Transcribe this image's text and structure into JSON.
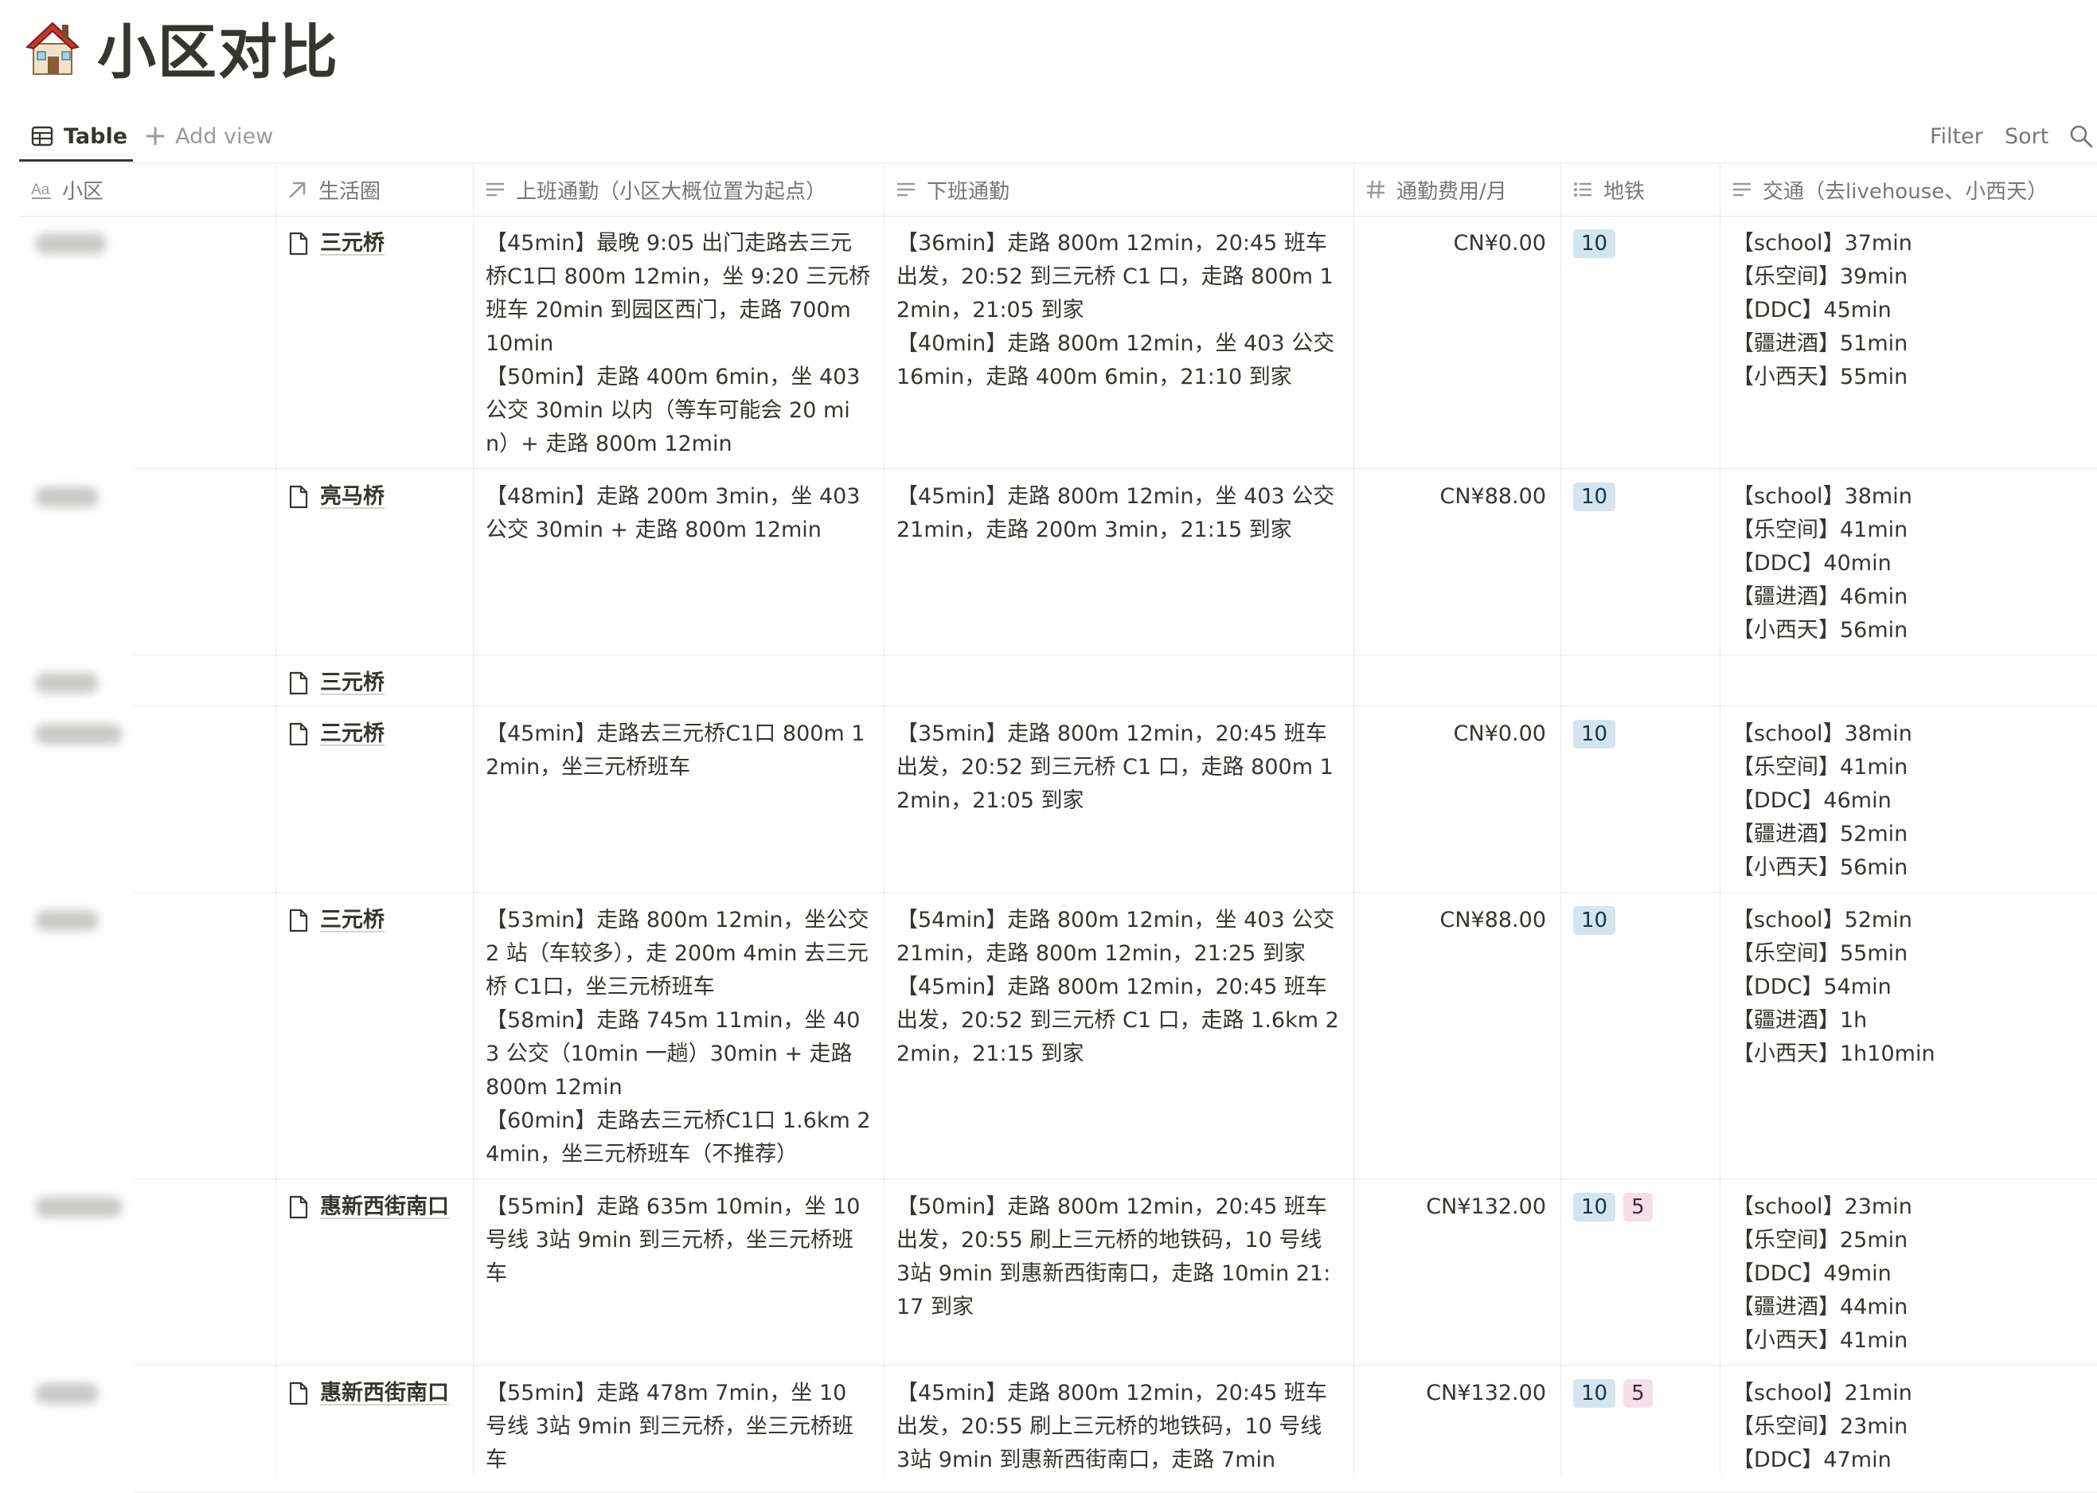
{
  "page": {
    "title": "小区对比",
    "icon": "house-icon"
  },
  "view_bar": {
    "tab_label": "Table",
    "add_view_label": "Add view",
    "filter_label": "Filter",
    "sort_label": "Sort"
  },
  "columns": [
    {
      "label": "小区",
      "icon": "title-aa-icon"
    },
    {
      "label": "生活圈",
      "icon": "relation-arrow-icon"
    },
    {
      "label": "上班通勤（小区大概位置为起点）",
      "icon": "text-lines-icon"
    },
    {
      "label": "下班通勤",
      "icon": "text-lines-icon"
    },
    {
      "label": "通勤费用/月",
      "icon": "number-hash-icon"
    },
    {
      "label": "地铁",
      "icon": "multi-select-list-icon"
    },
    {
      "label": "交通（去livehouse、小西天）",
      "icon": "text-lines-icon"
    }
  ],
  "rows": [
    {
      "circle": "三元桥",
      "morning": [
        "【45min】最晚 9:05 出门走路去三元桥C1口 800m 12min，坐 9:20 三元桥班车 20min 到园区西门，走路 700m 10min",
        "【50min】走路 400m 6min，坐 403 公交 30min 以内（等车可能会 20 min）+ 走路 800m 12min"
      ],
      "evening": [
        "【36min】走路 800m 12min，20:45 班车出发，20:52 到三元桥 C1 口，走路 800m 12min，21:05 到家",
        "【40min】走路 800m 12min，坐 403 公交 16min，走路 400m 6min，21:10 到家"
      ],
      "cost": "CN¥0.00",
      "subway": [
        "10"
      ],
      "transit": [
        "【school】37min",
        "【乐空间】39min",
        "【DDC】45min",
        "【疆进酒】51min",
        "【小西天】55min"
      ]
    },
    {
      "circle": "亮马桥",
      "morning": [
        "【48min】走路 200m 3min，坐 403 公交 30min + 走路 800m 12min"
      ],
      "evening": [
        "【45min】走路 800m 12min，坐 403 公交 21min，走路 200m 3min，21:15 到家"
      ],
      "cost": "CN¥88.00",
      "subway": [
        "10"
      ],
      "transit": [
        "【school】38min",
        "【乐空间】41min",
        "【DDC】40min",
        "【疆进酒】46min",
        "【小西天】56min"
      ]
    },
    {
      "circle": "三元桥",
      "morning": [],
      "evening": [],
      "cost": "",
      "subway": [],
      "transit": []
    },
    {
      "circle": "三元桥",
      "morning": [
        "【45min】走路去三元桥C1口 800m 12min，坐三元桥班车"
      ],
      "evening": [
        "【35min】走路 800m 12min，20:45 班车出发，20:52 到三元桥 C1 口，走路 800m 12min，21:05 到家"
      ],
      "cost": "CN¥0.00",
      "subway": [
        "10"
      ],
      "transit": [
        "【school】38min",
        "【乐空间】41min",
        "【DDC】46min",
        "【疆进酒】52min",
        "【小西天】56min"
      ]
    },
    {
      "circle": "三元桥",
      "morning": [
        "【53min】走路 800m 12min，坐公交 2 站（车较多），走 200m 4min 去三元桥 C1口，坐三元桥班车",
        "【58min】走路 745m 11min，坐 403 公交（10min 一趟）30min + 走路 800m 12min",
        "【60min】走路去三元桥C1口 1.6km 24min，坐三元桥班车（不推荐）"
      ],
      "evening": [
        "【54min】走路 800m 12min，坐 403 公交 21min，走路 800m 12min，21:25 到家",
        "【45min】走路 800m 12min，20:45 班车出发，20:52 到三元桥 C1 口，走路 1.6km 22min，21:15 到家"
      ],
      "cost": "CN¥88.00",
      "subway": [
        "10"
      ],
      "transit": [
        "【school】52min",
        "【乐空间】55min",
        "【DDC】54min",
        "【疆进酒】1h",
        "【小西天】1h10min"
      ]
    },
    {
      "circle": "惠新西街南口",
      "morning": [
        "【55min】走路 635m 10min，坐 10 号线 3站 9min 到三元桥，坐三元桥班车"
      ],
      "evening": [
        "【50min】走路 800m 12min，20:45 班车出发，20:55 刷上三元桥的地铁码，10 号线 3站 9min 到惠新西街南口，走路 10min 21:17 到家"
      ],
      "cost": "CN¥132.00",
      "subway": [
        "10",
        "5"
      ],
      "transit": [
        "【school】23min",
        "【乐空间】25min",
        "【DDC】49min",
        "【疆进酒】44min",
        "【小西天】41min"
      ]
    },
    {
      "circle": "惠新西街南口",
      "morning": [
        "【55min】走路 478m 7min，坐 10 号线 3站 9min 到三元桥，坐三元桥班车"
      ],
      "evening": [
        "【45min】走路 800m 12min，20:45 班车出发，20:55 刷上三元桥的地铁码，10 号线 3站 9min 到惠新西街南口，走路 7min"
      ],
      "cost": "CN¥132.00",
      "subway": [
        "10",
        "5"
      ],
      "transit": [
        "【school】21min",
        "【乐空间】23min",
        "【DDC】47min"
      ]
    }
  ]
}
